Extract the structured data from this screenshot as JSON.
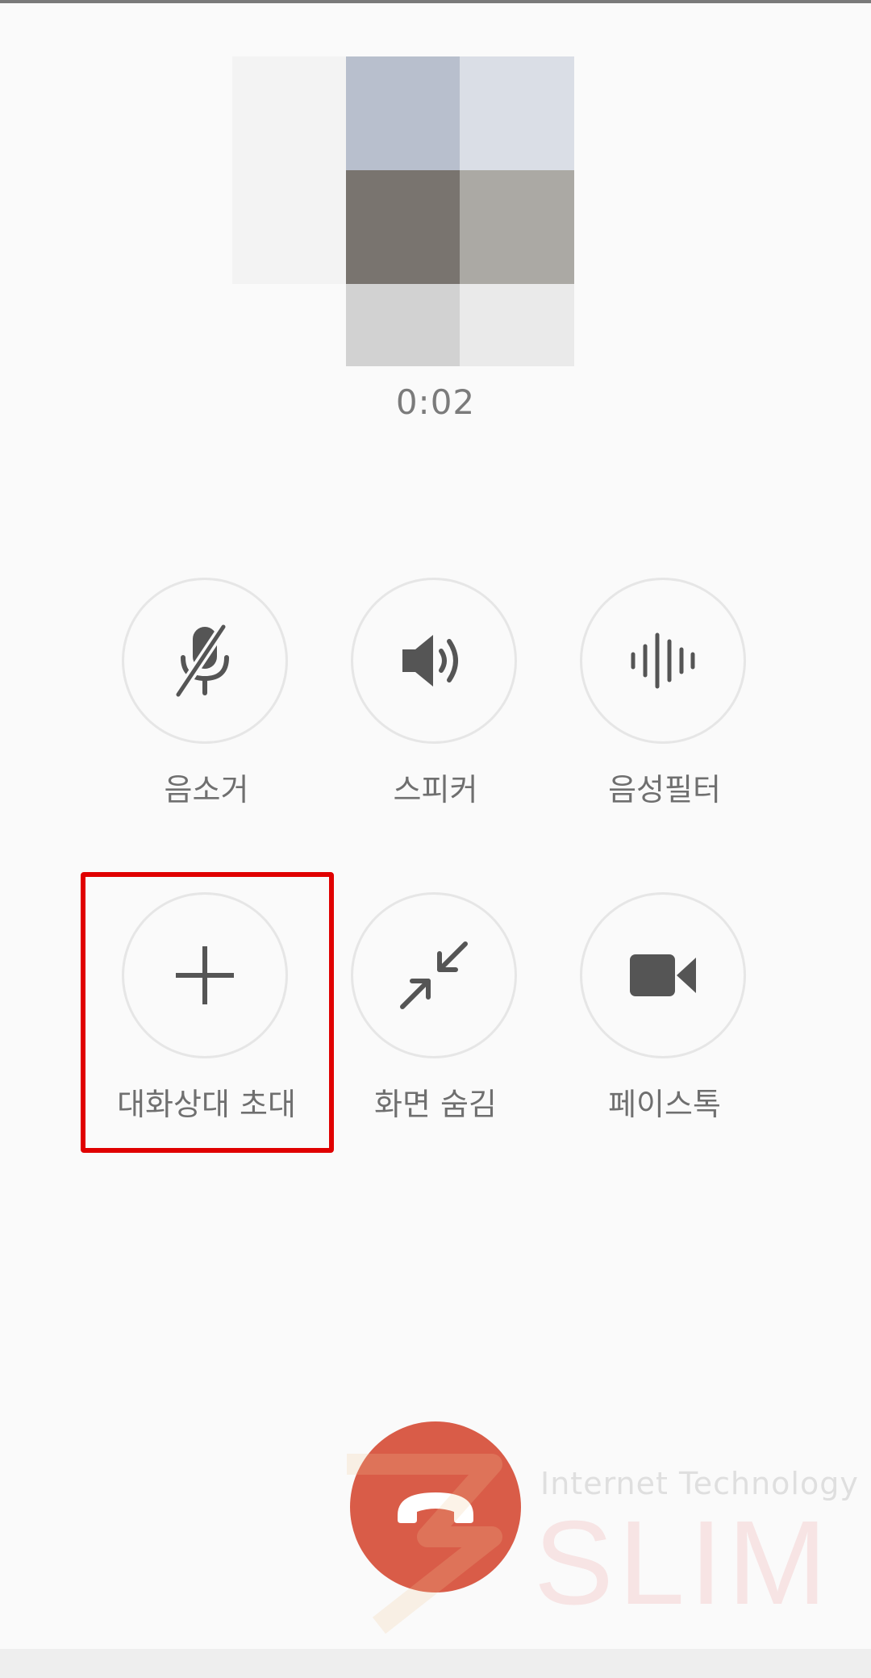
{
  "call": {
    "duration": "0:02"
  },
  "controls": {
    "mute": {
      "label": "음소거",
      "icon": "mic-off-icon"
    },
    "speaker": {
      "label": "스피커",
      "icon": "speaker-icon"
    },
    "voice_filter": {
      "label": "음성필터",
      "icon": "waveform-icon"
    },
    "invite": {
      "label": "대화상대 초대",
      "icon": "plus-icon"
    },
    "hide_screen": {
      "label": "화면 숨김",
      "icon": "minimize-arrows-icon"
    },
    "facetalk": {
      "label": "페이스톡",
      "icon": "video-camera-icon"
    }
  },
  "end_call": {
    "icon": "phone-hangup-icon"
  },
  "watermark": {
    "tagline": "Internet Technology",
    "brand": "SLIM"
  },
  "colors": {
    "background": "#fafafa",
    "icon": "#555555",
    "label": "#6f6f6f",
    "end_call": "#d95c48",
    "highlight": "#e00000"
  }
}
